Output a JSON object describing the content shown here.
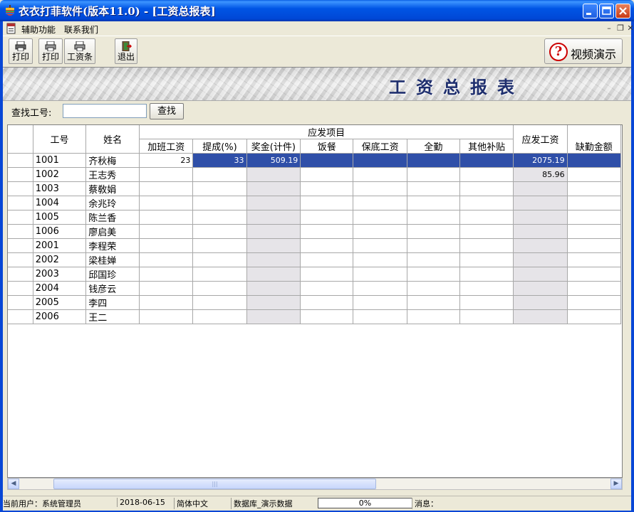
{
  "window": {
    "title": "衣衣打菲软件(版本11.0) - [工资总报表]"
  },
  "menu": {
    "items": [
      "辅助功能",
      "联系我们"
    ]
  },
  "toolbar": {
    "print1": "打印",
    "print2": "打印",
    "payslip": "工资条",
    "exit": "退出",
    "video": "视频演示"
  },
  "banner": {
    "title": "工资总报表"
  },
  "search": {
    "label": "查找工号:",
    "value": "",
    "button": "查找"
  },
  "grid": {
    "col_id": "工号",
    "col_name": "姓名",
    "group_header": "应发项目",
    "sub_columns": [
      "加班工资",
      "提成(%)",
      "奖金(计件)",
      "饭餐",
      "保底工资",
      "全勤",
      "其他补贴"
    ],
    "col_total": "应发工资",
    "col_absence": "缺勤金额",
    "rows": [
      {
        "id": "1001",
        "name": "齐秋梅",
        "overtime": "23",
        "commission": "33",
        "bonus": "509.19",
        "meal": "",
        "base": "",
        "attendance": "",
        "other": "",
        "total": "2075.19",
        "absence": ""
      },
      {
        "id": "1002",
        "name": "王志秀",
        "overtime": "",
        "commission": "",
        "bonus": "",
        "meal": "",
        "base": "",
        "attendance": "",
        "other": "",
        "total": "85.96",
        "absence": ""
      },
      {
        "id": "1003",
        "name": "蔡敎娟",
        "overtime": "",
        "commission": "",
        "bonus": "",
        "meal": "",
        "base": "",
        "attendance": "",
        "other": "",
        "total": "",
        "absence": ""
      },
      {
        "id": "1004",
        "name": "余兆玲",
        "overtime": "",
        "commission": "",
        "bonus": "",
        "meal": "",
        "base": "",
        "attendance": "",
        "other": "",
        "total": "",
        "absence": ""
      },
      {
        "id": "1005",
        "name": "陈兰香",
        "overtime": "",
        "commission": "",
        "bonus": "",
        "meal": "",
        "base": "",
        "attendance": "",
        "other": "",
        "total": "",
        "absence": ""
      },
      {
        "id": "1006",
        "name": "廖启美",
        "overtime": "",
        "commission": "",
        "bonus": "",
        "meal": "",
        "base": "",
        "attendance": "",
        "other": "",
        "total": "",
        "absence": ""
      },
      {
        "id": "2001",
        "name": "李程荣",
        "overtime": "",
        "commission": "",
        "bonus": "",
        "meal": "",
        "base": "",
        "attendance": "",
        "other": "",
        "total": "",
        "absence": ""
      },
      {
        "id": "2002",
        "name": "梁桂婵",
        "overtime": "",
        "commission": "",
        "bonus": "",
        "meal": "",
        "base": "",
        "attendance": "",
        "other": "",
        "total": "",
        "absence": ""
      },
      {
        "id": "2003",
        "name": "邱国珍",
        "overtime": "",
        "commission": "",
        "bonus": "",
        "meal": "",
        "base": "",
        "attendance": "",
        "other": "",
        "total": "",
        "absence": ""
      },
      {
        "id": "2004",
        "name": "钱彦云",
        "overtime": "",
        "commission": "",
        "bonus": "",
        "meal": "",
        "base": "",
        "attendance": "",
        "other": "",
        "total": "",
        "absence": ""
      },
      {
        "id": "2005",
        "name": "李四",
        "overtime": "",
        "commission": "",
        "bonus": "",
        "meal": "",
        "base": "",
        "attendance": "",
        "other": "",
        "total": "",
        "absence": ""
      },
      {
        "id": "2006",
        "name": "王二",
        "overtime": "",
        "commission": "",
        "bonus": "",
        "meal": "",
        "base": "",
        "attendance": "",
        "other": "",
        "total": "",
        "absence": ""
      }
    ]
  },
  "status": {
    "user": "当前用户：系统管理员",
    "date": "2018-06-15",
    "language": "简体中文",
    "database": "数据库_演示数据",
    "progress": "0%",
    "message": "消息："
  },
  "colors": {
    "titlebar": "#0055E5",
    "selection": "#2F4FA8",
    "banner_text": "#1F2F6E"
  }
}
